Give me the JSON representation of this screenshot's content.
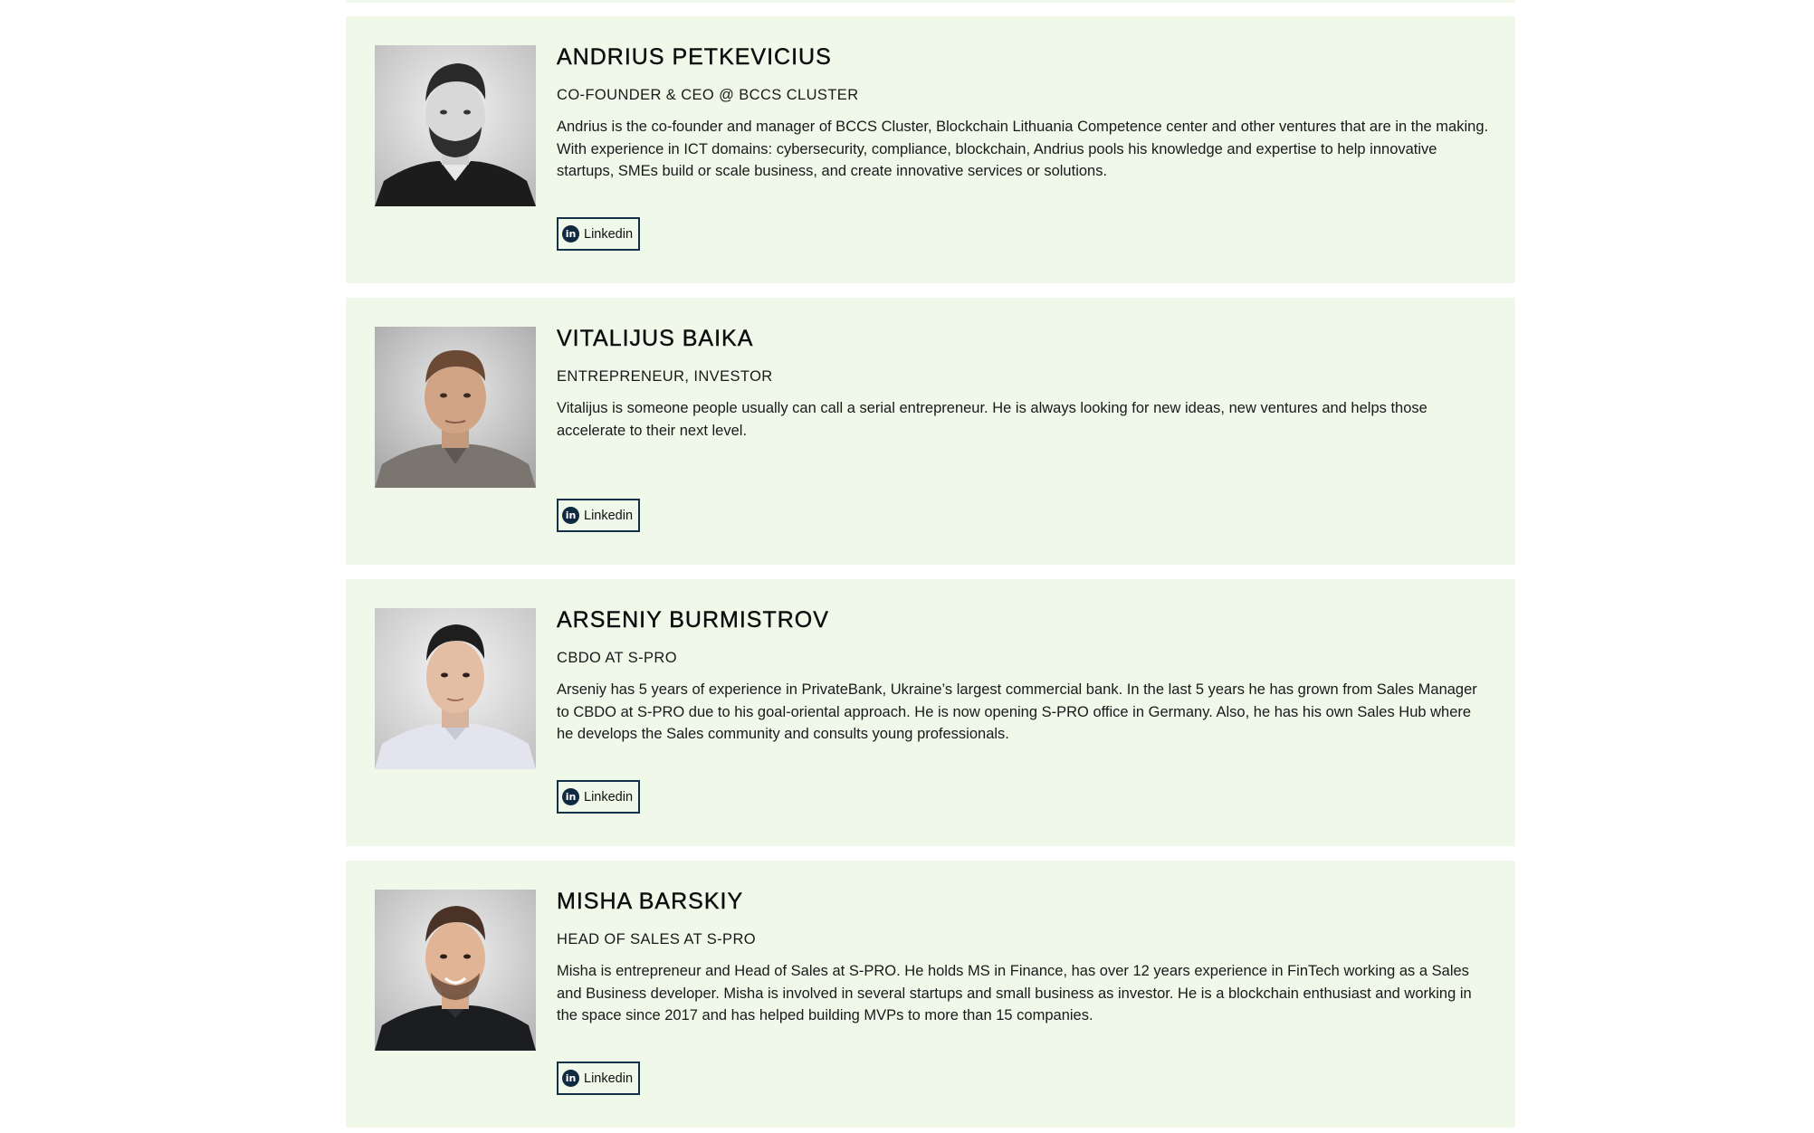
{
  "profiles": [
    {
      "name": "ANDRIUS PETKEVICIUS",
      "role": "CO-FOUNDER & CEO @ BCCS CLUSTER",
      "bio": "Andrius is the co-founder and manager of BCCS Cluster, Blockchain Lithuania Competence center and other ventures that are in the making. With experience in ICT domains: cybersecurity, compliance, blockchain, Andrius pools his knowledge and expertise to help innovative startups, SMEs build or scale business, and create innovative services or solutions.",
      "link_label": "Linkedin",
      "link_icon": "linkedin-icon"
    },
    {
      "name": "VITALIJUS BAIKA",
      "role": "ENTREPRENEUR, INVESTOR",
      "bio": "Vitalijus is someone people usually can call a serial entrepreneur. He is always looking for new ideas, new ventures and helps those accelerate to their next level.",
      "link_label": "Linkedin",
      "link_icon": "linkedin-icon"
    },
    {
      "name": "ARSENIY BURMISTROV",
      "role": "CBDO AT S-PRO",
      "bio": "Arseniy has 5 years of experience in PrivateBank, Ukraine’s largest commercial bank. In the last 5 years he has grown from Sales Manager to CBDO at S-PRO due to his goal-oriental approach. He is now opening S-PRO office in Germany. Also, he has his own Sales Hub where he develops the Sales community and consults young professionals.",
      "link_label": "Linkedin",
      "link_icon": "linkedin-icon"
    },
    {
      "name": "MISHA BARSKIY",
      "role": "HEAD OF SALES AT S-PRO",
      "bio": "Misha is entrepreneur and Head of Sales at S-PRO. He holds MS in Finance, has over 12 years experience in FinTech working as a Sales and Business developer. Misha is involved in several startups and small business as investor. He is a blockchain enthusiast and working in the space since 2017 and has helped building MVPs to more than 15 companies.",
      "link_label": "Linkedin",
      "link_icon": "linkedin-icon"
    }
  ],
  "colors": {
    "card_background": "#eff8e9",
    "button_border": "#15314a",
    "icon_background": "#0f2a40"
  }
}
